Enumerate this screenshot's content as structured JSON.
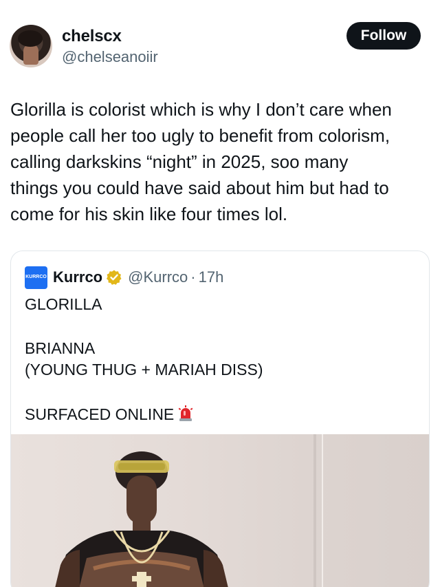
{
  "post": {
    "author_name": "chelscx",
    "author_handle": "@chelseanoiir",
    "follow_label": "Follow",
    "text": "Glorilla is colorist which is why I don’t care when\npeople call her too ugly to benefit from colorism,\ncalling darkskins “night” in 2025, soo many\nthings you could have said about him but had to\ncome for his skin like four times lol."
  },
  "quote": {
    "author_name": "Kurrco",
    "author_handle": "@Kurrco",
    "separator": "·",
    "time": "17h",
    "avatar_text": "KURRCO",
    "lines": [
      "GLORILLA",
      "BRIANNA",
      "(YOUNG THUG + MARIAH DISS)",
      "SURFACED ONLINE"
    ],
    "siren_icon": "rotating-light-icon",
    "verified_icon": "gold-verified-badge-icon"
  },
  "colors": {
    "text_primary": "#0f1419",
    "text_secondary": "#536471",
    "follow_bg": "#0f1419",
    "verified_gold": "#e2b719",
    "border": "#e1e6ea"
  }
}
